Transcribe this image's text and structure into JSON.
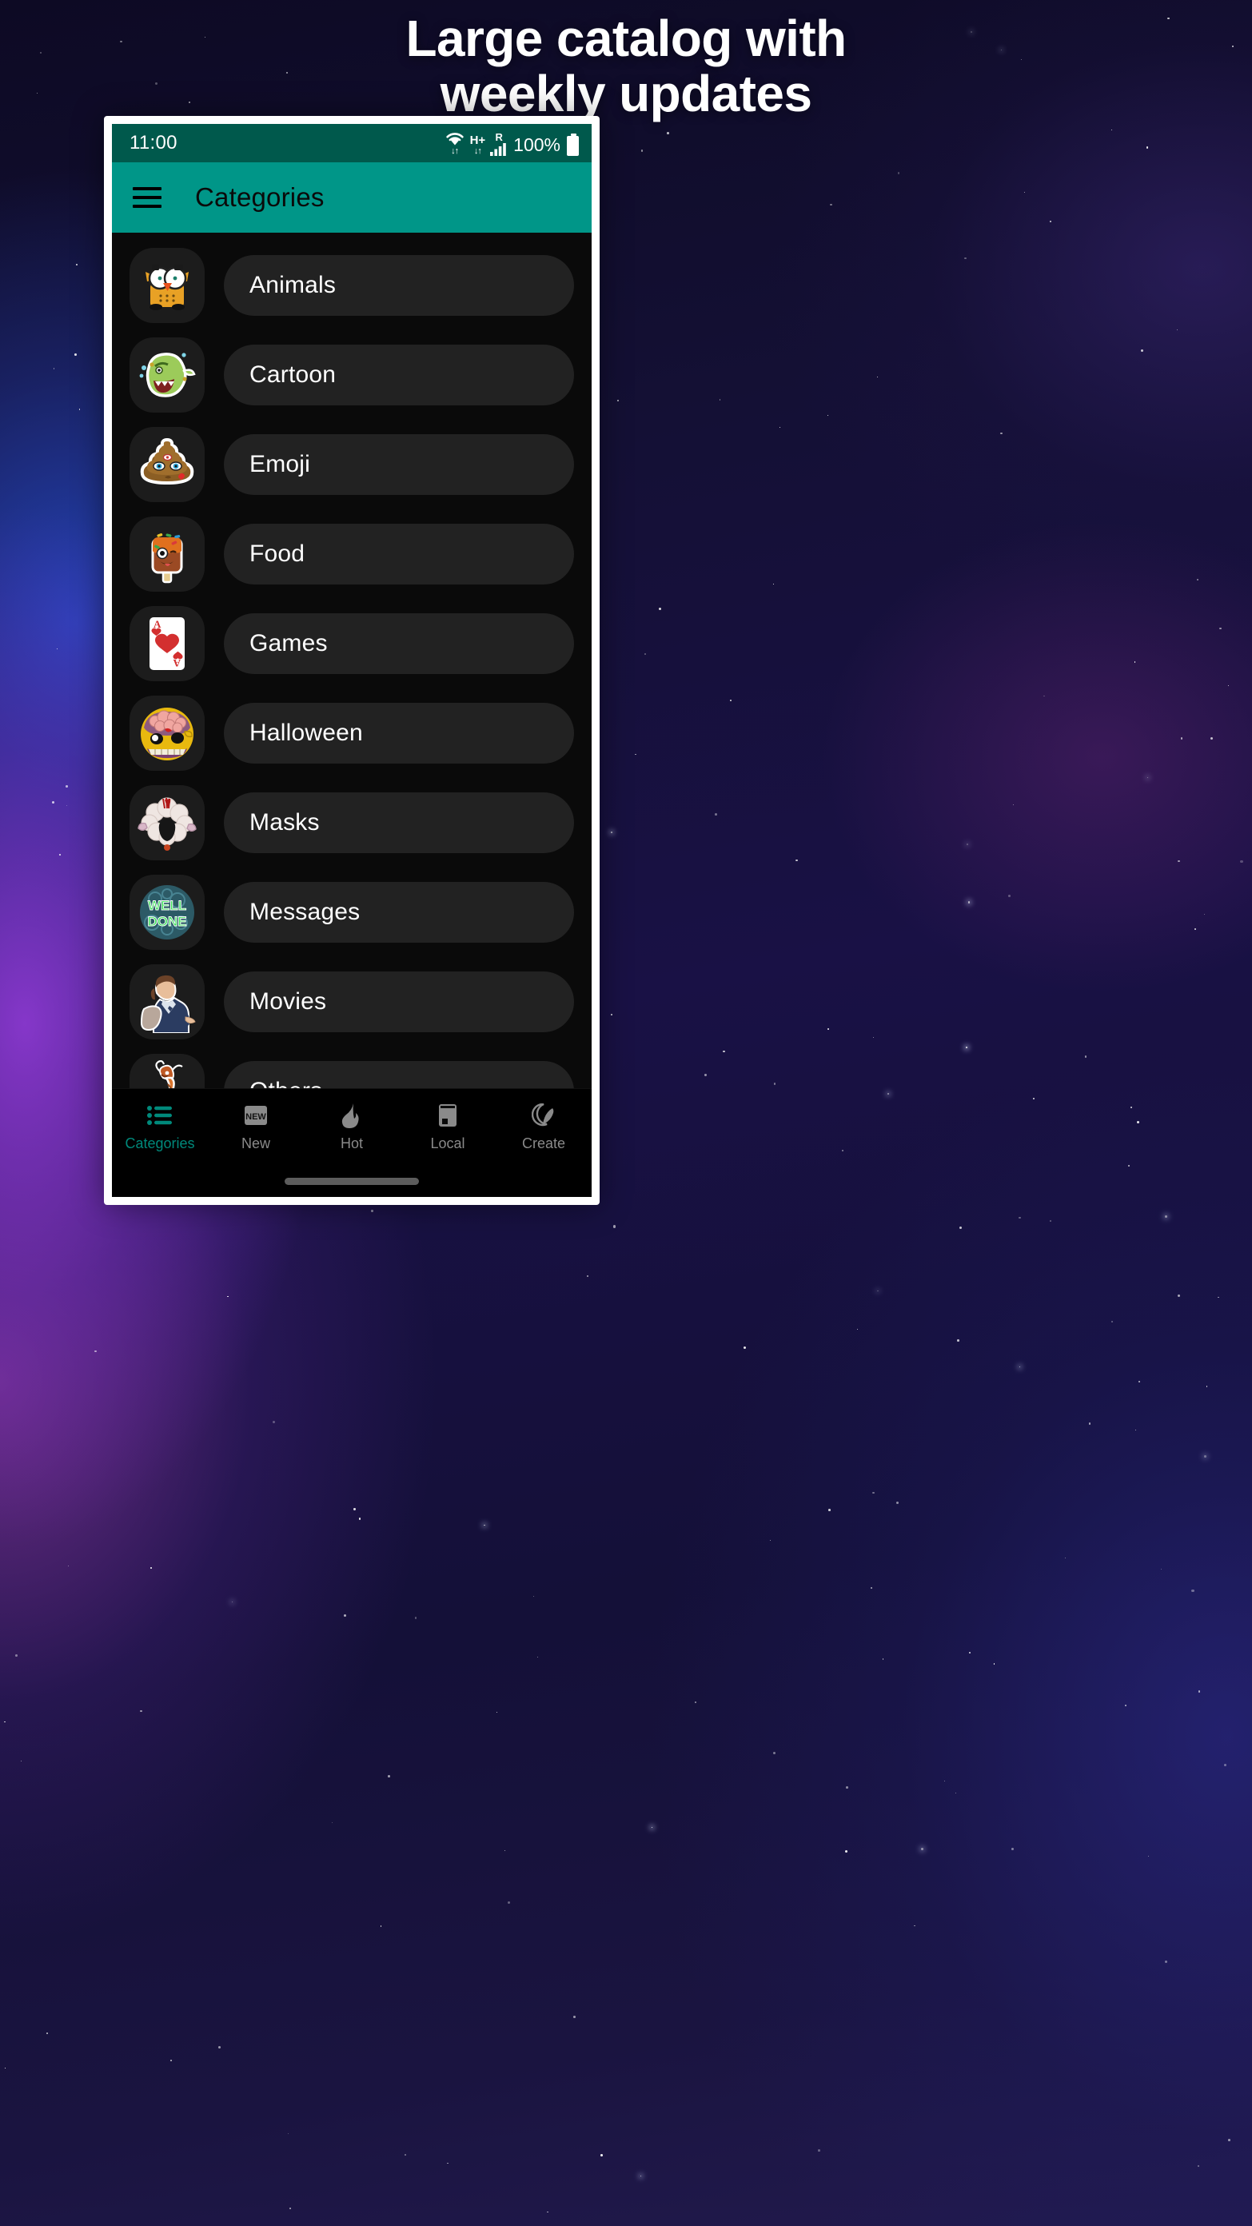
{
  "headline": {
    "line1": "Large catalog with",
    "line2": "weekly updates"
  },
  "phone": {
    "status_bar": {
      "time": "11:00",
      "wifi_icon": "wifi-icon",
      "network_type": "H+",
      "roaming": "R",
      "signal_icon": "signal-bars-icon",
      "battery_percent": "100%",
      "battery_icon": "battery-full-icon"
    },
    "app_bar": {
      "menu_icon": "hamburger-menu-icon",
      "title": "Categories"
    },
    "categories": [
      {
        "label": "Animals",
        "thumb": "owl-sticker"
      },
      {
        "label": "Cartoon",
        "thumb": "green-monster-sticker"
      },
      {
        "label": "Emoji",
        "thumb": "poop-kiss-emoji-sticker"
      },
      {
        "label": "Food",
        "thumb": "ice-cream-bar-sticker"
      },
      {
        "label": "Games",
        "thumb": "ace-of-hearts-card-sticker"
      },
      {
        "label": "Halloween",
        "thumb": "brain-zombie-mask-sticker"
      },
      {
        "label": "Masks",
        "thumb": "sheep-mask-sticker"
      },
      {
        "label": "Messages",
        "thumb": "well-done-neon-text-sticker"
      },
      {
        "label": "Movies",
        "thumb": "man-in-blue-suit-sticker"
      },
      {
        "label": "Others",
        "thumb": "orange-creature-sticker"
      }
    ],
    "bottom_nav": [
      {
        "label": "Categories",
        "icon": "list-icon",
        "active": true
      },
      {
        "label": "New",
        "icon": "new-badge-icon",
        "active": false
      },
      {
        "label": "Hot",
        "icon": "flame-icon",
        "active": false
      },
      {
        "label": "Local",
        "icon": "device-icon",
        "active": false
      },
      {
        "label": "Create",
        "icon": "quill-pen-icon",
        "active": false
      }
    ],
    "new_badge_text": "NEW"
  },
  "colors": {
    "accent_teal": "#009688",
    "status_bar_teal": "#00594C",
    "active_nav_teal": "#00897B",
    "screen_bg": "#0a0a0a",
    "pill_bg": "#222222",
    "frame": "#ffffff"
  }
}
